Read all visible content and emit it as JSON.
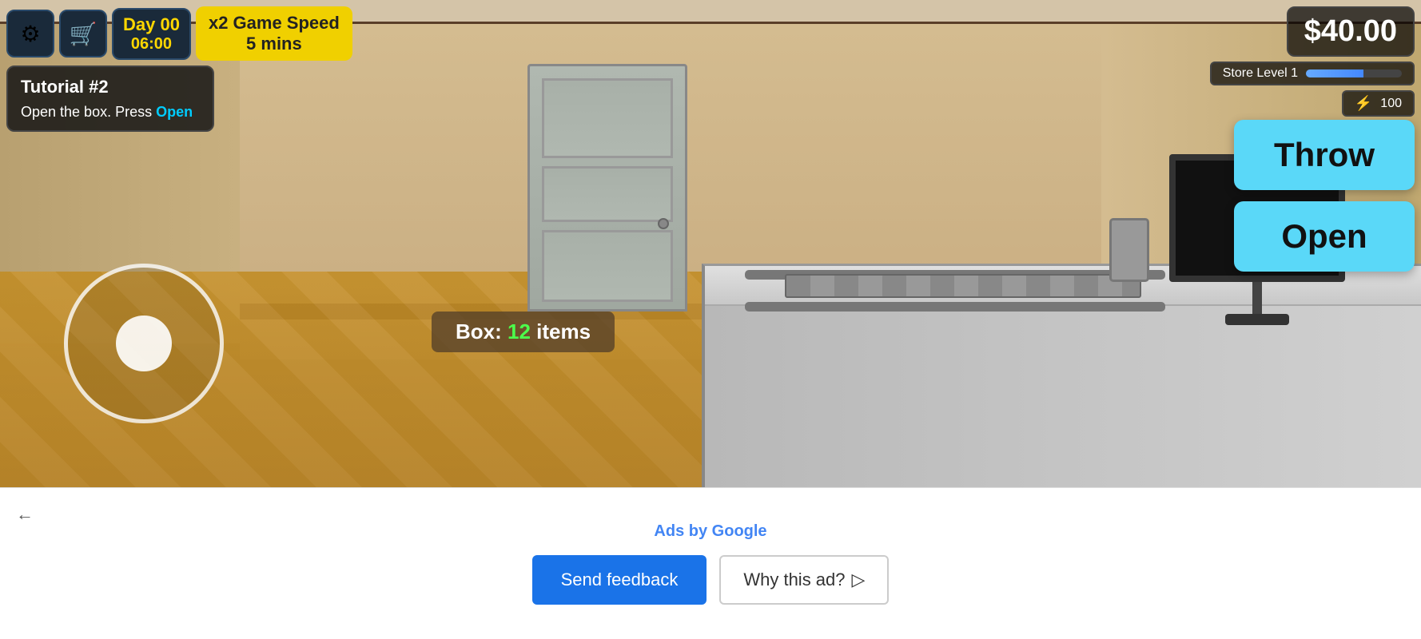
{
  "hud": {
    "settings_icon": "⚙",
    "cart_icon": "🛒",
    "day_label": "Day 00",
    "time_label": "06:00",
    "speed_label": "x2 Game Speed",
    "speed_sub": "5 mins",
    "money": "$40.00",
    "store_level": "Store Level 1",
    "xp": "100",
    "xp_fill_pct": 60
  },
  "tutorial": {
    "title": "Tutorial #2",
    "text_before": "Open the box. Press ",
    "link_text": "Open"
  },
  "box_info": {
    "label": "Box: ",
    "count": "12",
    "suffix": " items"
  },
  "actions": {
    "throw_label": "Throw",
    "open_label": "Open"
  },
  "ad": {
    "ads_by": "Ads by ",
    "google": "Google",
    "send_feedback": "Send feedback",
    "why_this_ad": "Why this ad?"
  }
}
